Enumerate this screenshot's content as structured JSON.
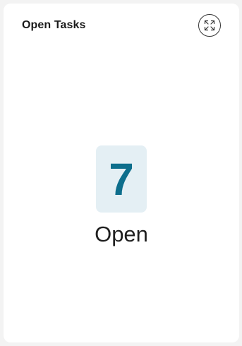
{
  "card": {
    "title": "Open Tasks",
    "expand_icon": "expand-arrows-icon",
    "count": "7",
    "status_label": "Open",
    "accent_color": "#0d6e8c",
    "count_background": "#e4eff4"
  }
}
